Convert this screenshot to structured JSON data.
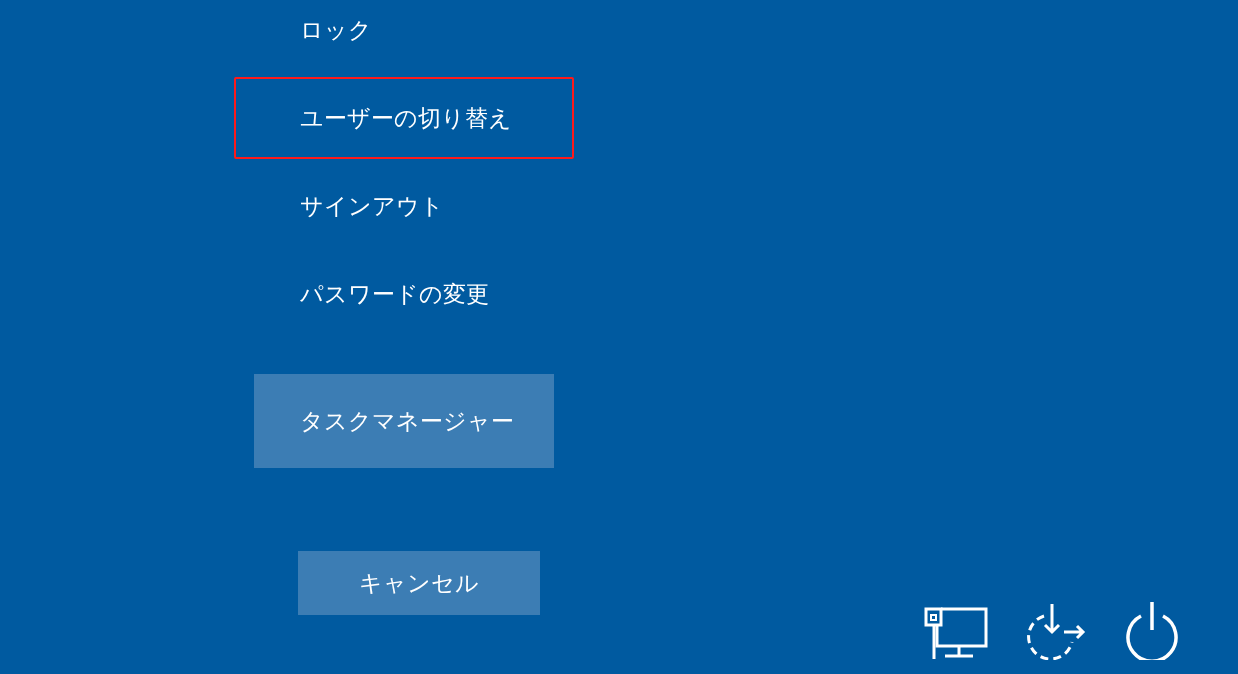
{
  "menu_items": [
    {
      "label": "ロック",
      "highlighted": false
    },
    {
      "label": "ユーザーの切り替え",
      "highlighted": true
    },
    {
      "label": "サインアウト",
      "highlighted": false
    },
    {
      "label": "パスワードの変更",
      "highlighted": false
    }
  ],
  "task_manager_button": {
    "label": "タスクマネージャー"
  },
  "cancel_button": {
    "label": "キャンセル"
  }
}
